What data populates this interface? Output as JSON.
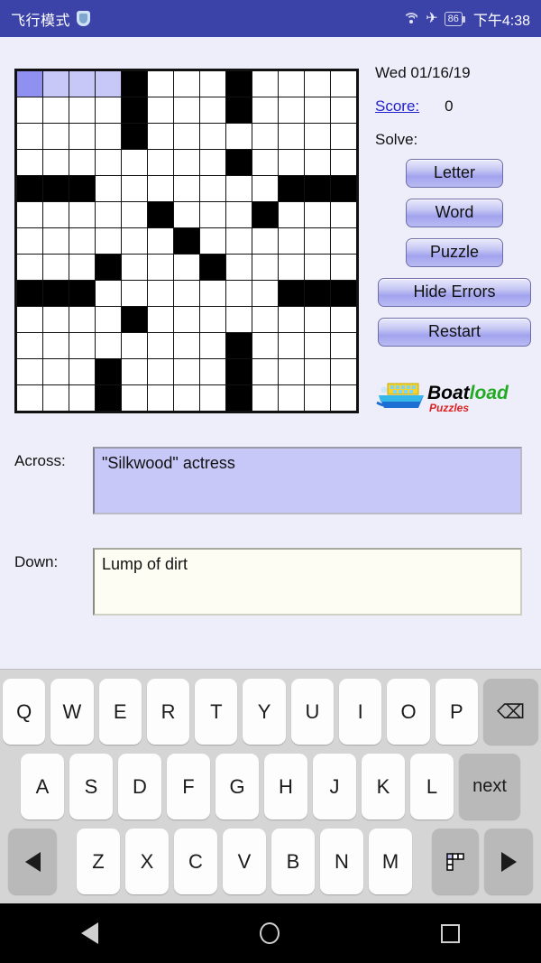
{
  "statusbar": {
    "title": "飞行模式",
    "shield_icon": "shield-icon",
    "wifi_icon": "wifi-icon",
    "airplane_icon": "✈",
    "battery_level": "86",
    "clock": "下午4:38"
  },
  "panel": {
    "date": "Wed 01/16/19",
    "score_label": "Score:",
    "score_value": "0",
    "solve_label": "Solve:",
    "buttons": [
      {
        "label": "Letter",
        "width": "narrow"
      },
      {
        "label": "Word",
        "width": "narrow"
      },
      {
        "label": "Puzzle",
        "width": "narrow"
      },
      {
        "label": "Hide Errors",
        "width": "wide"
      },
      {
        "label": "Restart",
        "width": "wide"
      }
    ],
    "logo": {
      "part1": "Boat",
      "part2": "load",
      "part3": "Puzzles",
      "color1": "#2222cc",
      "color2": "#22aa22",
      "color3": "#dd2222"
    }
  },
  "clues": {
    "across_label": "Across:",
    "across_text": "\"Silkwood\" actress",
    "down_label": "Down:",
    "down_text": "Lump of dirt"
  },
  "grid": {
    "rows": 13,
    "cols": 13,
    "current_cell": [
      0,
      0
    ],
    "current_word_cells": [
      [
        0,
        1
      ],
      [
        0,
        2
      ],
      [
        0,
        3
      ]
    ],
    "colors": {
      "current": "#8f90f0",
      "word": "#c7c8f8",
      "black": "#000000",
      "white": "#ffffff"
    },
    "black_squares": [
      [
        0,
        4
      ],
      [
        0,
        8
      ],
      [
        1,
        4
      ],
      [
        1,
        8
      ],
      [
        2,
        4
      ],
      [
        3,
        8
      ],
      [
        4,
        0
      ],
      [
        4,
        1
      ],
      [
        4,
        2
      ],
      [
        4,
        10
      ],
      [
        4,
        11
      ],
      [
        4,
        12
      ],
      [
        5,
        5
      ],
      [
        5,
        9
      ],
      [
        6,
        6
      ],
      [
        7,
        3
      ],
      [
        7,
        7
      ],
      [
        8,
        0
      ],
      [
        8,
        1
      ],
      [
        8,
        2
      ],
      [
        8,
        10
      ],
      [
        8,
        11
      ],
      [
        8,
        12
      ],
      [
        9,
        4
      ],
      [
        10,
        8
      ],
      [
        11,
        3
      ],
      [
        11,
        8
      ],
      [
        12,
        3
      ],
      [
        12,
        8
      ]
    ]
  },
  "keyboard": {
    "row1": [
      "Q",
      "W",
      "E",
      "R",
      "T",
      "Y",
      "U",
      "I",
      "O",
      "P"
    ],
    "row1_fn": "⌫",
    "row2": [
      "A",
      "S",
      "D",
      "F",
      "G",
      "H",
      "J",
      "K",
      "L"
    ],
    "row2_fn": "next",
    "row3": [
      "Z",
      "X",
      "C",
      "V",
      "B",
      "N",
      "M"
    ],
    "row3_left": "◀",
    "row3_grid": "grid-icon",
    "row3_right": "▶"
  },
  "navbar": {
    "back": "back-icon",
    "home": "home-icon",
    "recents": "recents-icon"
  }
}
